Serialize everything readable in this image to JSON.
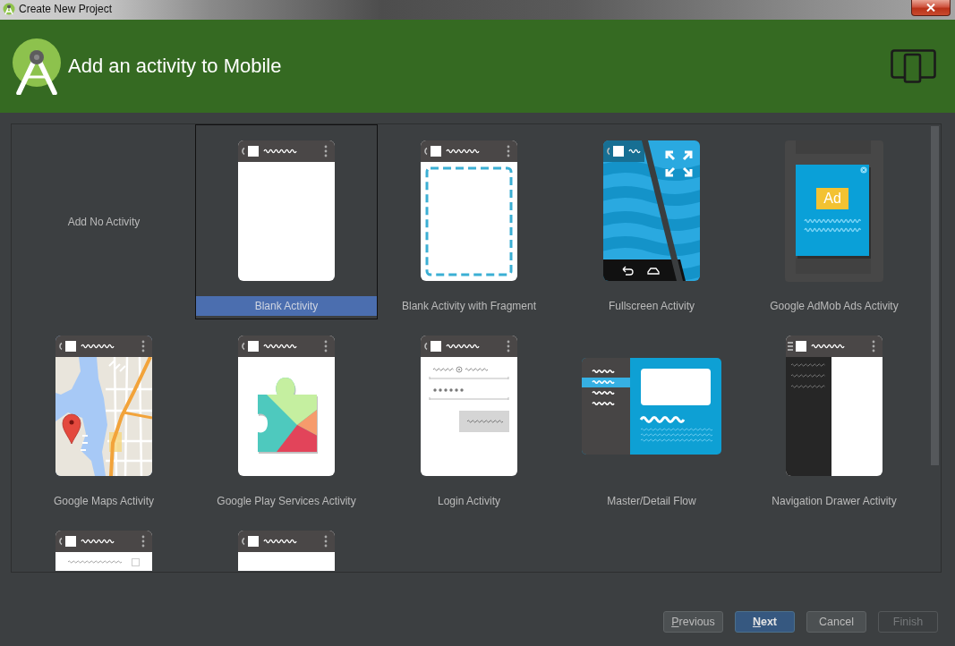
{
  "window": {
    "title": "Create New Project"
  },
  "header": {
    "title": "Add an activity to Mobile"
  },
  "templates": [
    {
      "label": "Add No Activity",
      "kind": "none",
      "selected": false
    },
    {
      "label": "Blank Activity",
      "kind": "blank",
      "selected": true
    },
    {
      "label": "Blank Activity with Fragment",
      "kind": "fragment",
      "selected": false
    },
    {
      "label": "Fullscreen Activity",
      "kind": "fullscreen",
      "selected": false
    },
    {
      "label": "Google AdMob Ads Activity",
      "kind": "admob",
      "badge": "Ad",
      "selected": false
    },
    {
      "label": "Google Maps Activity",
      "kind": "map",
      "selected": false
    },
    {
      "label": "Google Play Services Activity",
      "kind": "puzzle",
      "selected": false
    },
    {
      "label": "Login Activity",
      "kind": "login",
      "selected": false
    },
    {
      "label": "Master/Detail Flow",
      "kind": "masterdetail",
      "selected": false
    },
    {
      "label": "Navigation Drawer Activity",
      "kind": "drawer",
      "selected": false
    },
    {
      "kind": "settings",
      "selected": false
    },
    {
      "kind": "plain",
      "selected": false
    }
  ],
  "buttons": [
    {
      "label": "Previous",
      "mnemonic": true,
      "default": false,
      "disabled": false
    },
    {
      "label": "Next",
      "mnemonic": true,
      "default": true,
      "disabled": false
    },
    {
      "label": "Cancel",
      "mnemonic": false,
      "default": false,
      "disabled": false
    },
    {
      "label": "Finish",
      "mnemonic": false,
      "default": false,
      "disabled": true
    }
  ]
}
